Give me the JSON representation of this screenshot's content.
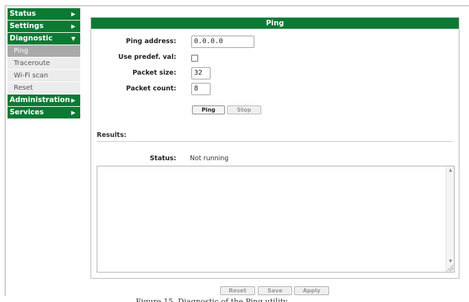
{
  "sidebar": {
    "items": [
      {
        "label": "Status",
        "arrow": "▶"
      },
      {
        "label": "Settings",
        "arrow": "▶"
      },
      {
        "label": "Diagnostic",
        "arrow": "▼"
      }
    ],
    "diagnostic_children": [
      {
        "label": "Ping",
        "active": true
      },
      {
        "label": "Traceroute",
        "active": false
      },
      {
        "label": "Wi-Fi scan",
        "active": false
      },
      {
        "label": "Reset",
        "active": false
      }
    ],
    "items_after": [
      {
        "label": "Administration",
        "arrow": "▶"
      },
      {
        "label": "Services",
        "arrow": "▶"
      }
    ]
  },
  "panel": {
    "title": "Ping",
    "ping_address_label": "Ping address:",
    "ping_address_value": "0.0.0.0",
    "use_predef_label": "Use predef. val:",
    "use_predef_checked": false,
    "packet_size_label": "Packet size:",
    "packet_size_value": "32",
    "packet_count_label": "Packet count:",
    "packet_count_value": "8",
    "ping_button": "Ping",
    "stop_button": "Stop",
    "results_title": "Results:",
    "status_label": "Status:",
    "status_value": "Not running"
  },
  "footer": {
    "reset_button": "Reset",
    "save_button": "Save",
    "apply_button": "Apply"
  },
  "caption": "Figure 15. Diagnostic of the Ping utility"
}
